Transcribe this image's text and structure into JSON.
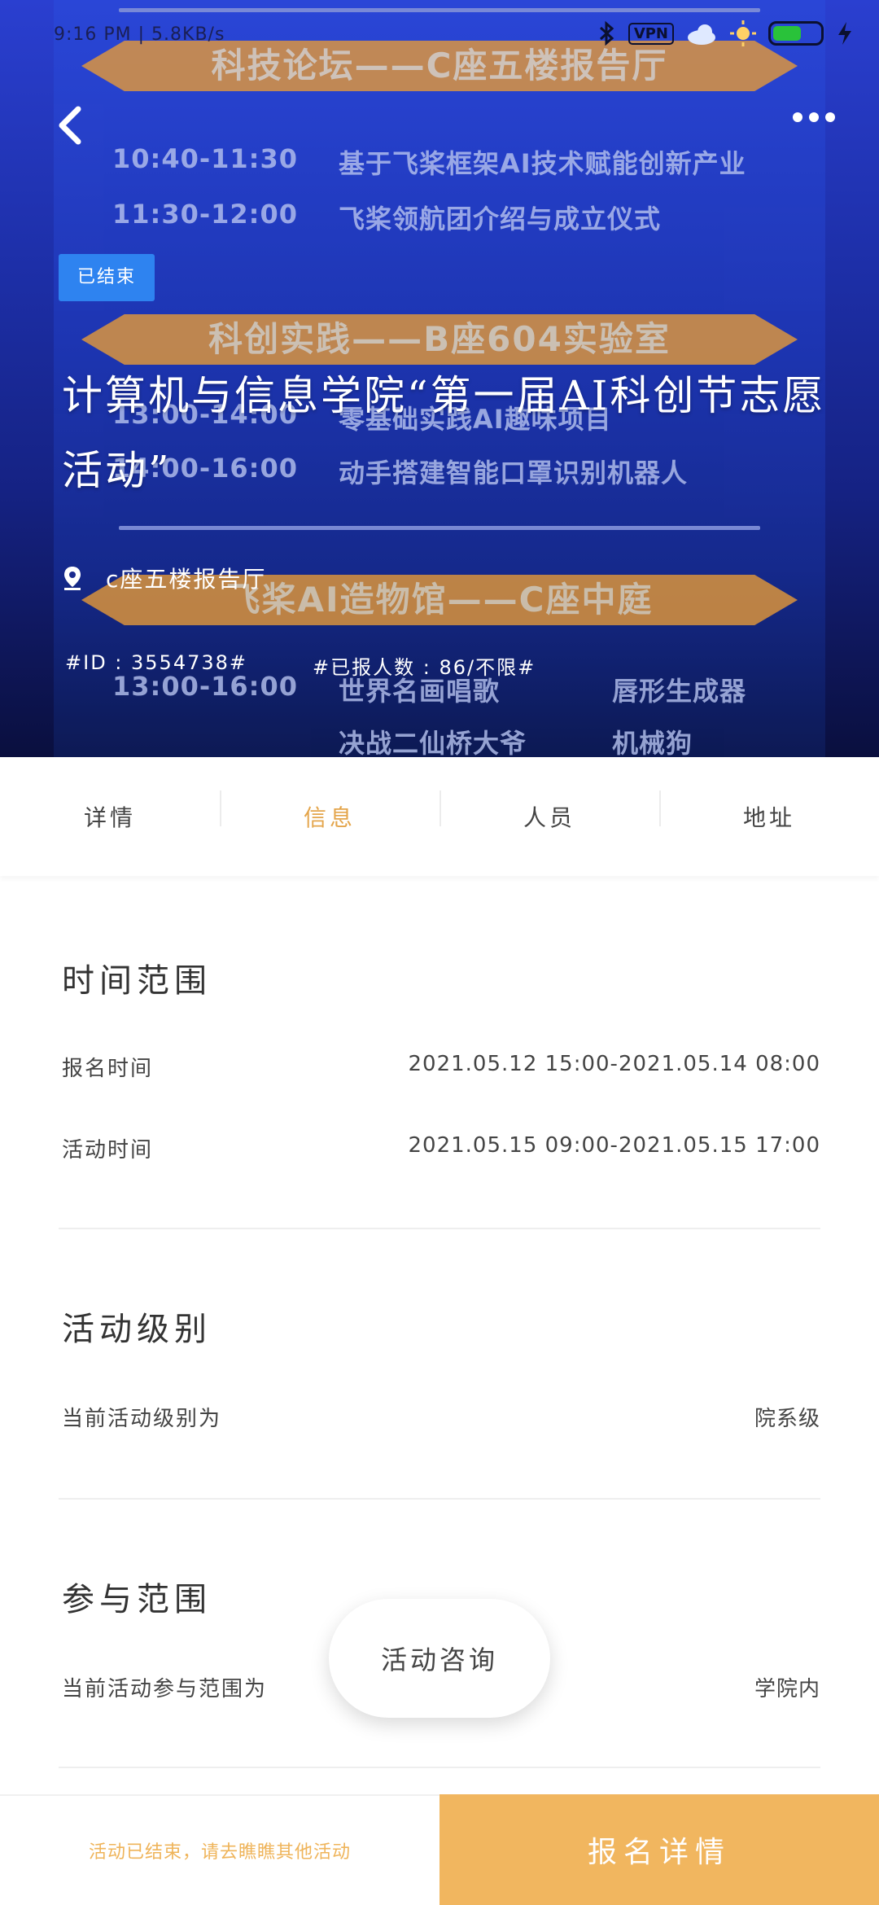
{
  "status_bar": {
    "time": "9:16 PM | 5.8KB/s",
    "vpn": "VPN"
  },
  "poster": {
    "banner1": "科技论坛——C座五楼报告厅",
    "rows1": [
      {
        "time": "10:40-11:30",
        "text": "基于飞桨框架AI技术赋能创新产业"
      },
      {
        "time": "11:30-12:00",
        "text": "飞桨领航团介绍与成立仪式"
      }
    ],
    "banner2": "科创实践——B座604实验室",
    "rows2": [
      {
        "time": "13:00-14:00",
        "text": "零基础实践AI趣味项目"
      },
      {
        "time": "14:00-16:00",
        "text": "动手搭建智能口罩识别机器人"
      }
    ],
    "banner3": "飞桨AI造物馆——C座中庭",
    "rows3": [
      {
        "time": "13:00-16:00",
        "text": "世界名画唱歌",
        "text2": "唇形生成器"
      },
      {
        "time": "",
        "text": "决战二仙桥大爷",
        "text2": "机械狗"
      }
    ]
  },
  "header": {
    "status_badge": "已结束",
    "title": "计算机与信息学院“第一届AI科创节志愿活动”",
    "location": "c座五楼报告厅",
    "event_id": "#ID : 3554738#",
    "enrolled": "#已报人数 : 86/不限#"
  },
  "tabs": [
    {
      "label": "详情",
      "active": false
    },
    {
      "label": "信息",
      "active": true
    },
    {
      "label": "人员",
      "active": false
    },
    {
      "label": "地址",
      "active": false
    }
  ],
  "time_range": {
    "title": "时间范围",
    "signup_label": "报名时间",
    "signup_value": "2021.05.12 15:00-2021.05.14 08:00",
    "event_label": "活动时间",
    "event_value": "2021.05.15 09:00-2021.05.15 17:00"
  },
  "level": {
    "title": "活动级别",
    "label": "当前活动级别为",
    "value": "院系级"
  },
  "scope": {
    "title": "参与范围",
    "label": "当前活动参与范围为",
    "value": "学院内"
  },
  "consult_button": "活动咨询",
  "bottom": {
    "note": "活动已结束，请去瞧瞧其他活动",
    "button": "报名详情"
  },
  "colors": {
    "accent": "#f1b65f",
    "tab_active": "#e4a54b",
    "badge": "#2e83f0"
  }
}
